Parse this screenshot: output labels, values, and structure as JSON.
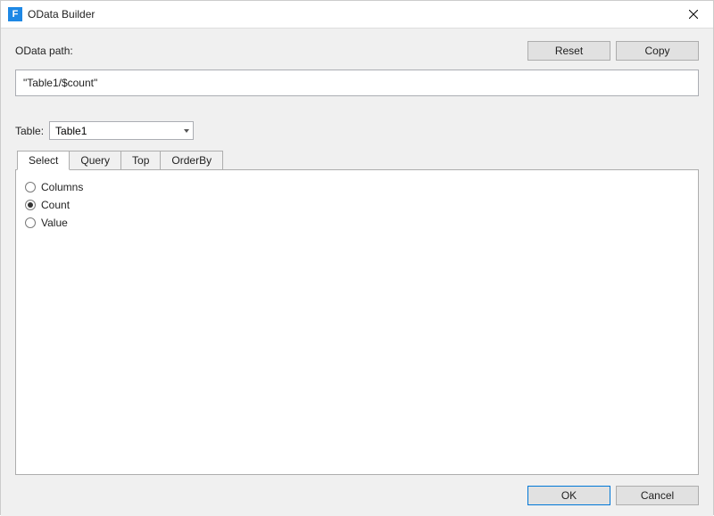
{
  "window": {
    "title": "OData Builder",
    "icon_letter": "F"
  },
  "toolbar": {
    "path_label": "OData path:",
    "reset_label": "Reset",
    "copy_label": "Copy"
  },
  "path": {
    "value": "\"Table1/$count\""
  },
  "table": {
    "label": "Table:",
    "selected": "Table1"
  },
  "tabs": [
    {
      "label": "Select",
      "active": true
    },
    {
      "label": "Query",
      "active": false
    },
    {
      "label": "Top",
      "active": false
    },
    {
      "label": "OrderBy",
      "active": false
    }
  ],
  "selectTab": {
    "options": [
      {
        "label": "Columns",
        "checked": false
      },
      {
        "label": "Count",
        "checked": true
      },
      {
        "label": "Value",
        "checked": false
      }
    ]
  },
  "footer": {
    "ok_label": "OK",
    "cancel_label": "Cancel"
  }
}
